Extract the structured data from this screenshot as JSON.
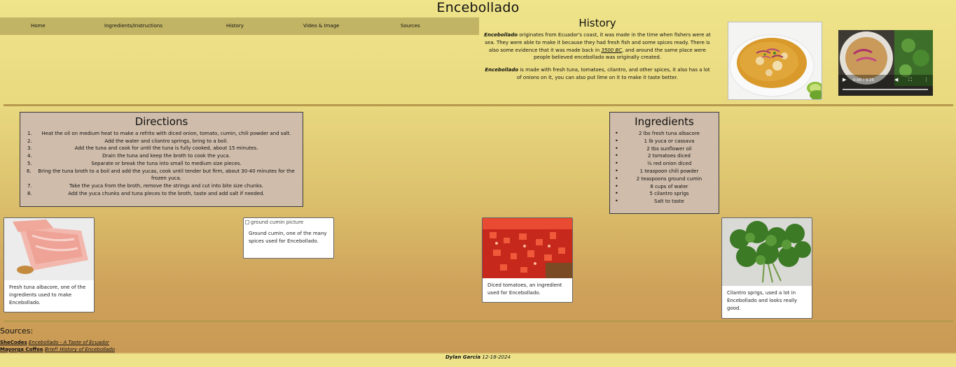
{
  "site": {
    "title": "Encebollado"
  },
  "nav": {
    "items": [
      {
        "label": "Home"
      },
      {
        "label": "Ingredients/Instructions"
      },
      {
        "label": "History"
      },
      {
        "label": "Video & Image"
      },
      {
        "label": "Sources"
      }
    ]
  },
  "history": {
    "heading": "History",
    "p1_name": "Encebollado",
    "p1_text": " originates from Ecuador's coast, it was made in the time when fishers were at sea. They were able to make it because they had fresh fish and some spices ready. There is also some evidence that it was made back in ",
    "p1_link": "3500 BC",
    "p1_tail": ", and around the same place were people believed encebollado was originally created.",
    "p2_name": "Encebollado",
    "p2_text": " is made with fresh tuna, tomatoes, cilantro, and other spices, it also has a lot of onions on it, you can also put lime on it to make it taste better."
  },
  "video": {
    "time": "0:00 / 3:25"
  },
  "directions": {
    "heading": "Directions",
    "steps": [
      {
        "num": "1.",
        "text": "Heat the oil on medium heat to make a refrito with diced onion, tomato, cumin, chili powder and salt."
      },
      {
        "num": "2.",
        "text": "Add the water and cilantro springs, bring to a boil."
      },
      {
        "num": "3.",
        "text": "Add the tuna and cook for until the tuna is fully cooked, about 15 minutes."
      },
      {
        "num": "4.",
        "text": "Drain the tuna and keep the broth to cook the yuca."
      },
      {
        "num": "5.",
        "text": "Separate or break the tuna into small to medium size pieces."
      },
      {
        "num": "6.",
        "text": "Bring the tuna broth to a boil and add the yucas, cook until tender but firm, about 30-40 minutes for the frozen yuca."
      },
      {
        "num": "7.",
        "text": "Take the yuca from the broth, remove the strings and cut into bite size chunks."
      },
      {
        "num": "8.",
        "text": "Add the yuca chunks and tuna pieces to the broth, taste and add salt if needed."
      }
    ]
  },
  "ingredients": {
    "heading": "Ingredients",
    "items": [
      "2 lbs fresh tuna albacore",
      "1 lb yuca or cassava",
      "2 tbs sunflower oil",
      "2 tomatoes diced",
      "½ red onion diced",
      "1 teaspoon chili powder",
      "2 teaspoons ground cumin",
      "8 cups of water",
      "5 cilantro sprigs",
      "Salt to taste"
    ]
  },
  "cards": [
    {
      "caption": "Fresh tuna albacore, one of the ingredients used to make Encebollado."
    },
    {
      "alt": "ground cumin picture",
      "caption": "Ground cumin, one of the many spices used for Encebollado."
    },
    {
      "caption": "Diced tomatoes, an ingredient used for Encebollado."
    },
    {
      "caption": "Cilantro sprigs, used a lot in Encebollado and looks really good."
    }
  ],
  "sources": {
    "heading": "Sources:",
    "items": [
      {
        "site": "SheCodes",
        "title": "Encebollado - A Taste of Ecuador"
      },
      {
        "site": "Mayorga Coffee",
        "title": "Brief! History of Encebollado"
      }
    ]
  },
  "footer": {
    "author": "Dylan Garcia",
    "date": " 12-18-2024"
  }
}
